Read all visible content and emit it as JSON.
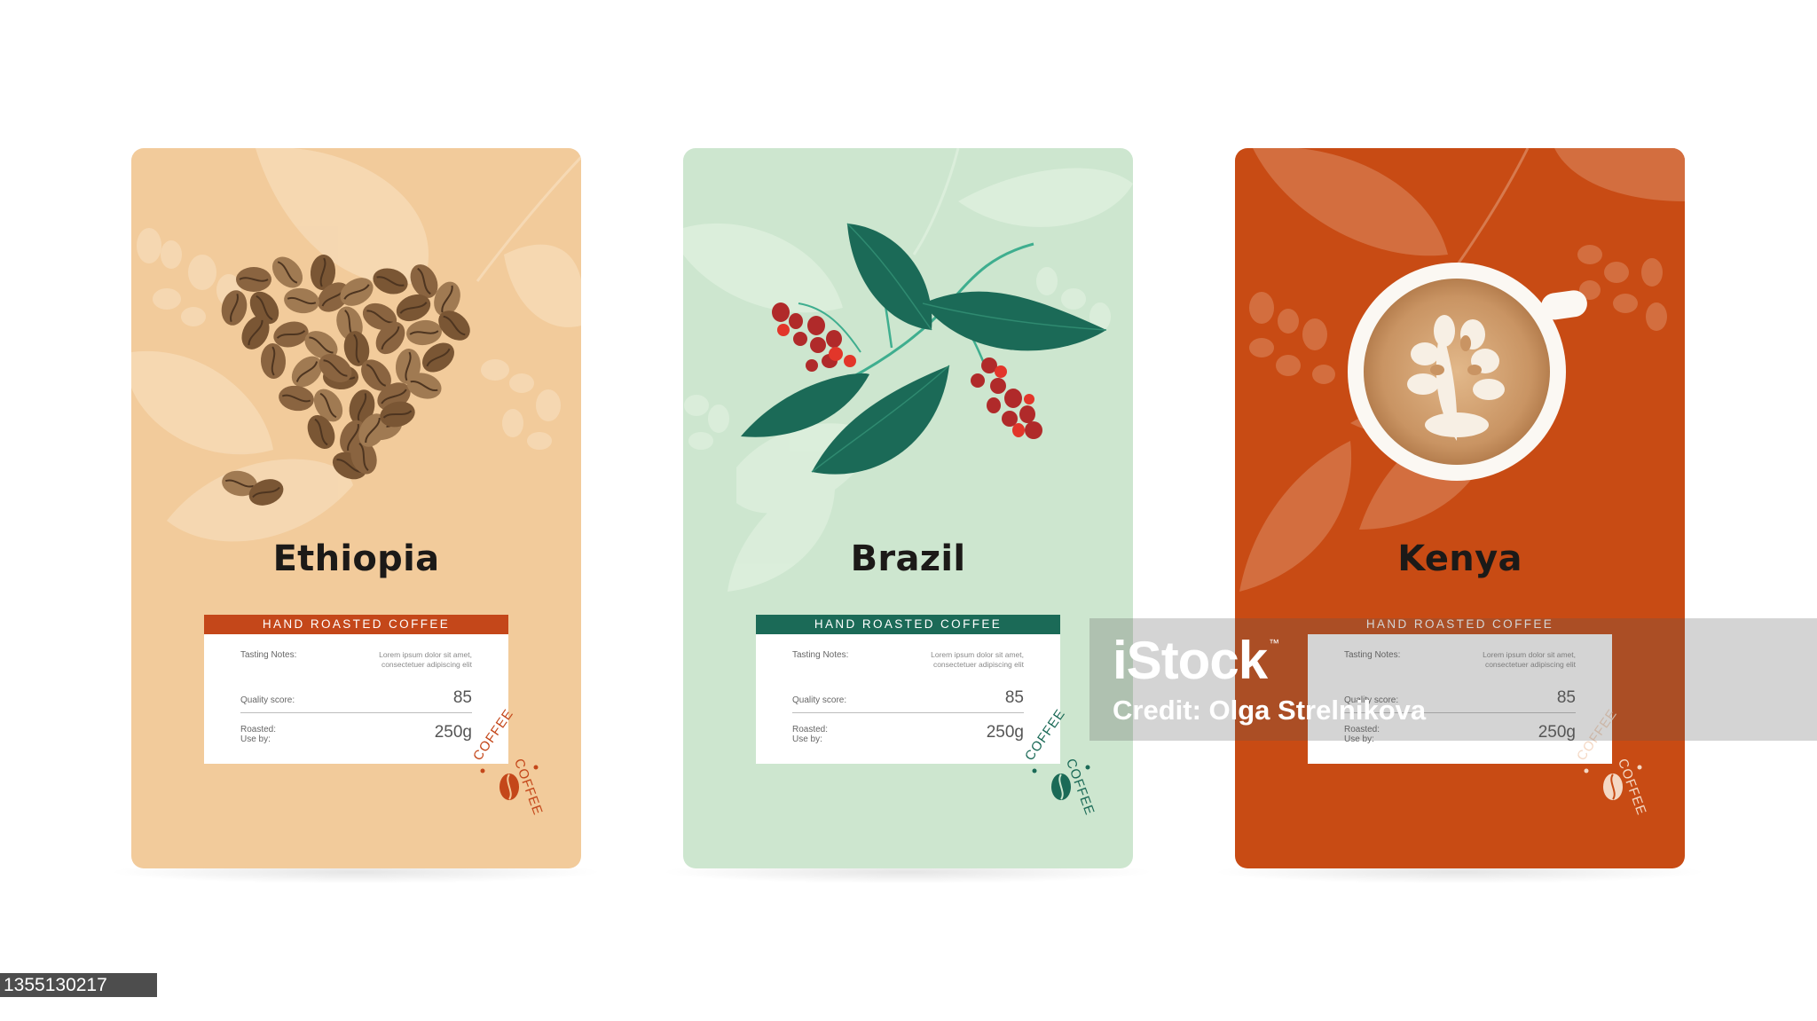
{
  "colors": {
    "ethiopia_bg": "#f2cb9b",
    "ethiopia_accent": "#c4471a",
    "brazil_bg": "#cde6cf",
    "brazil_accent": "#1b6a57",
    "kenya_bg": "#c84b14",
    "kenya_accent": "#c84b14"
  },
  "cards": [
    {
      "name": "Ethiopia",
      "band": "HAND ROASTED COFFEE",
      "tasting_label": "Tasting Notes:",
      "tasting_text": "Lorem ipsum dolor sit amet, consectetuer adipiscing elit",
      "quality_label": "Quality score:",
      "quality_value": "85",
      "roasted_label": "Roasted:",
      "useby_label": "Use by:",
      "weight": "250g",
      "stamp_top": "COFFEE",
      "stamp_right": "COFFEE",
      "illustration": "coffee-bean-heart"
    },
    {
      "name": "Brazil",
      "band": "HAND ROASTED COFFEE",
      "tasting_label": "Tasting Notes:",
      "tasting_text": "Lorem ipsum dolor sit amet, consectetuer adipiscing elit",
      "quality_label": "Quality score:",
      "quality_value": "85",
      "roasted_label": "Roasted:",
      "useby_label": "Use by:",
      "weight": "250g",
      "stamp_top": "COFFEE",
      "stamp_right": "COFFEE",
      "illustration": "coffee-branch-with-cherries"
    },
    {
      "name": "Kenya",
      "band": "HAND ROASTED COFFEE",
      "tasting_label": "Tasting Notes:",
      "tasting_text": "Lorem ipsum dolor sit amet, consectetuer adipiscing elit",
      "quality_label": "Quality score:",
      "quality_value": "85",
      "roasted_label": "Roasted:",
      "useby_label": "Use by:",
      "weight": "250g",
      "stamp_top": "COFFEE",
      "stamp_right": "COFFEE",
      "illustration": "latte-cup-top-view"
    }
  ],
  "watermark": {
    "brand": "iStock",
    "trademark": "™",
    "credit": "Credit: Olga Strelnikova"
  },
  "stock_id": "1355130217"
}
